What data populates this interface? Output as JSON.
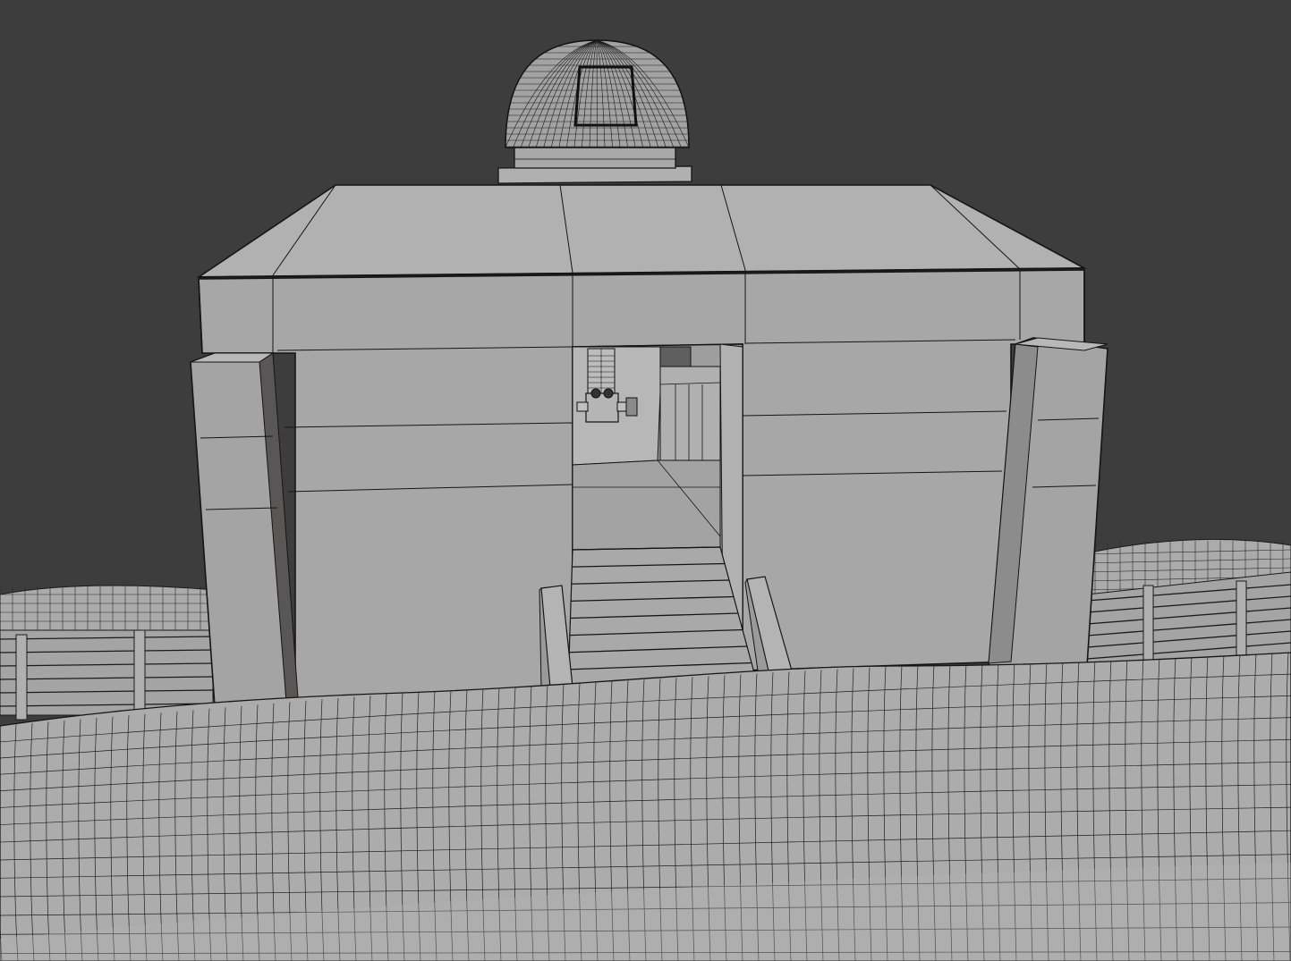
{
  "viewport": {
    "background": "#3d3d3d",
    "shading": "solid",
    "wireframe": true
  },
  "colors": {
    "background": "#3d3d3d",
    "surface": "#a9a9a9",
    "surface_light": "#b4b4b4",
    "surface_dark": "#8f8f8f",
    "edge": "#151515",
    "wire": "#1e1e1e"
  },
  "scene": {
    "objects": [
      {
        "name": "bunker-body",
        "type": "building"
      },
      {
        "name": "roof-slab",
        "type": "roof"
      },
      {
        "name": "dome-observatory",
        "type": "dome"
      },
      {
        "name": "dome-base-ring",
        "type": "ring"
      },
      {
        "name": "left-pillar",
        "type": "pillar"
      },
      {
        "name": "right-pillar",
        "type": "pillar"
      },
      {
        "name": "doorway",
        "type": "opening"
      },
      {
        "name": "entrance-stairs",
        "type": "stairs"
      },
      {
        "name": "stair-railing-left",
        "type": "railing"
      },
      {
        "name": "stair-railing-right",
        "type": "railing"
      },
      {
        "name": "interior-machine",
        "type": "prop"
      },
      {
        "name": "trench-fence-left",
        "type": "fence"
      },
      {
        "name": "trench-fence-right",
        "type": "fence"
      },
      {
        "name": "sandbag-berm-front",
        "type": "terrain"
      },
      {
        "name": "sandbag-berm-back",
        "type": "terrain"
      }
    ],
    "stair_steps": 8,
    "fence_planks": 6
  }
}
